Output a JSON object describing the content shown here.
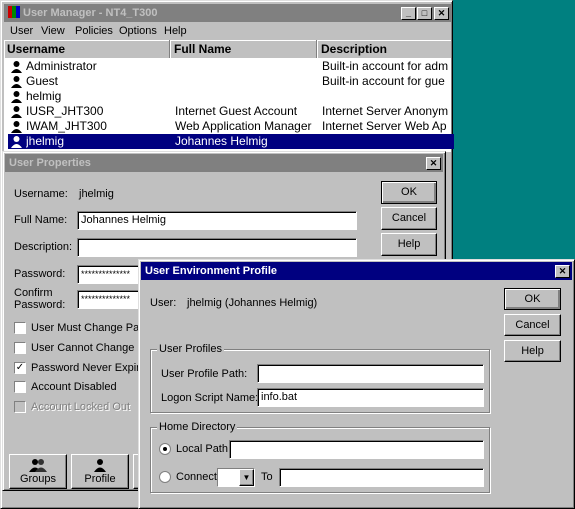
{
  "user_manager": {
    "title": "User Manager - NT4_T300",
    "menu": [
      "User",
      "View",
      "Policies",
      "Options",
      "Help"
    ],
    "columns": [
      "Username",
      "Full Name",
      "Description"
    ],
    "users": [
      {
        "username": "Administrator",
        "full_name": "",
        "description": "Built-in account for adm"
      },
      {
        "username": "Guest",
        "full_name": "",
        "description": "Built-in account for gue"
      },
      {
        "username": "helmig",
        "full_name": "",
        "description": ""
      },
      {
        "username": "IUSR_JHT300",
        "full_name": "Internet Guest Account",
        "description": "Internet Server Anonym"
      },
      {
        "username": "IWAM_JHT300",
        "full_name": "Web Application Manager",
        "description": "Internet Server Web Ap"
      },
      {
        "username": "jhelmig",
        "full_name": "Johannes Helmig",
        "description": ""
      }
    ],
    "selected_user": "jhelmig"
  },
  "user_properties": {
    "title": "User Properties",
    "username_label": "Username:",
    "username_value": "jhelmig",
    "fullname_label": "Full Name:",
    "fullname_value": "Johannes Helmig",
    "description_label": "Description:",
    "description_value": "",
    "password_label": "Password:",
    "password_value": "**************",
    "confirm_label_1": "Confirm",
    "confirm_label_2": "Password:",
    "confirm_value": "**************",
    "checkboxes": [
      {
        "label": "User Must Change Passw",
        "checked": false,
        "disabled": false
      },
      {
        "label": "User Cannot Change Pa",
        "checked": false,
        "disabled": false
      },
      {
        "label": "Password Never Expires",
        "checked": true,
        "disabled": false
      },
      {
        "label": "Account Disabled",
        "checked": false,
        "disabled": false
      },
      {
        "label": "Account Locked Out",
        "checked": false,
        "disabled": true
      }
    ],
    "ok_label": "OK",
    "cancel_label": "Cancel",
    "help_label": "Help",
    "groups_label": "Groups",
    "profile_label": "Profile",
    "check_mark": "✓"
  },
  "env_profile": {
    "title": "User Environment Profile",
    "user_label": "User:",
    "user_value": "jhelmig (Johannes Helmig)",
    "ok_label": "OK",
    "cancel_label": "Cancel",
    "help_label": "Help",
    "user_profiles_group": "User Profiles",
    "profile_path_label": "User Profile Path:",
    "profile_path_value": "",
    "logon_script_label": "Logon Script Name:",
    "logon_script_value": "info.bat",
    "home_dir_group": "Home Directory",
    "local_path_label": "Local Path:",
    "local_path_value": "",
    "connect_label": "Connect",
    "to_label": "To",
    "to_value": "",
    "selected_home_option": "local_path"
  },
  "colors": {
    "desktop": "#008080",
    "active_title": "#000080",
    "inactive_title": "#808080",
    "window_face": "#c0c0c0"
  }
}
